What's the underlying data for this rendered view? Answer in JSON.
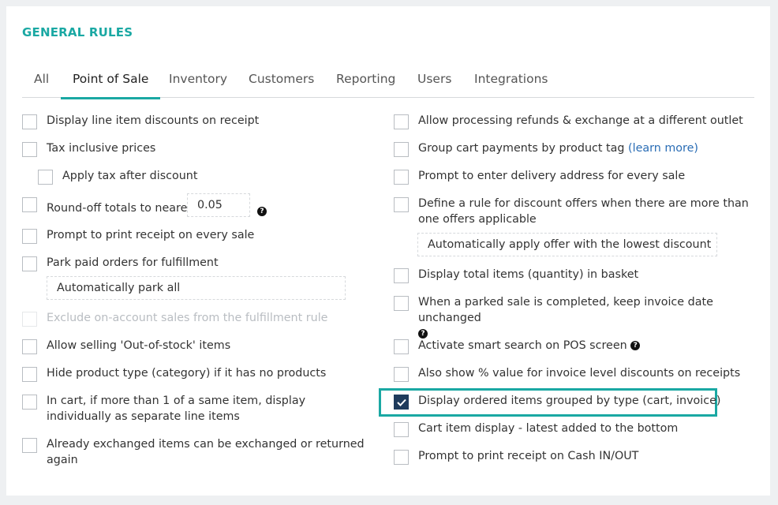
{
  "section_title": "GENERAL RULES",
  "tabs": [
    {
      "label": "All"
    },
    {
      "label": "Point of Sale"
    },
    {
      "label": "Inventory"
    },
    {
      "label": "Customers"
    },
    {
      "label": "Reporting"
    },
    {
      "label": "Users"
    },
    {
      "label": "Integrations"
    }
  ],
  "left": {
    "display_line_item_discounts": "Display line item discounts on receipt",
    "tax_inclusive_prices": "Tax inclusive prices",
    "apply_tax_after_discount": "Apply tax after discount",
    "round_off_totals": "Round-off totals to nearest",
    "round_off_value": "0.05",
    "prompt_print_receipt": "Prompt to print receipt on every sale",
    "park_paid_orders": "Park paid orders for fulfillment",
    "park_option": "Automatically park all",
    "exclude_on_account": "Exclude on-account sales from the fulfillment rule",
    "allow_out_of_stock": "Allow selling 'Out-of-stock' items",
    "hide_product_type": "Hide product type (category) if it has no products",
    "cart_individual_line": "In cart, if more than 1 of a same item, display individually as separate line items",
    "already_exchanged": "Already exchanged items can be exchanged or returned again"
  },
  "right": {
    "allow_refunds_other_outlet": "Allow processing refunds & exchange at a different outlet",
    "group_cart_payments": "Group cart payments by product tag",
    "learn_more": "(learn more)",
    "prompt_delivery_address": "Prompt to enter delivery address for every sale",
    "discount_rule": "Define a rule for discount offers when there are more than one offers applicable",
    "discount_option": "Automatically apply offer with the lowest discount",
    "display_total_items": "Display total items (quantity) in basket",
    "parked_sale_date": "When a parked sale is completed, keep invoice date unchanged",
    "smart_search": "Activate smart search on POS screen",
    "show_percent_value": "Also show % value for invoice level discounts on receipts",
    "display_grouped": "Display ordered items grouped by type (cart, invoice)",
    "cart_latest_bottom": "Cart item display - latest added to the bottom",
    "prompt_cash_in_out": "Prompt to print receipt on Cash IN/OUT"
  },
  "help_glyph": "?",
  "colors": {
    "accent": "#1aa8a3",
    "checked": "#1f3b5c",
    "link": "#2a6db5"
  }
}
